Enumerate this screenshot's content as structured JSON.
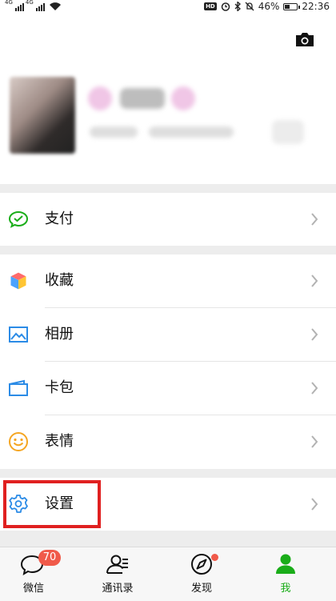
{
  "status_bar": {
    "signal1_label": "4G",
    "signal2_label": "4G",
    "hd_label": "HD",
    "battery_percent": "46%",
    "battery_level": 0.46,
    "time": "22:36"
  },
  "profile": {
    "camera_icon": "camera-icon"
  },
  "menu": {
    "pay": {
      "label": "支付",
      "icon": "wechat-pay-icon",
      "color": "#1aad19"
    },
    "favorites": {
      "label": "收藏",
      "icon": "cube-icon"
    },
    "album": {
      "label": "相册",
      "icon": "picture-icon",
      "color": "#2b8be6"
    },
    "cards": {
      "label": "卡包",
      "icon": "card-icon",
      "color": "#2b8be6"
    },
    "stickers": {
      "label": "表情",
      "icon": "smile-icon",
      "color": "#f5a623"
    },
    "settings": {
      "label": "设置",
      "icon": "gear-icon",
      "color": "#2b8be6"
    }
  },
  "tabbar": {
    "tabs": [
      {
        "label": "微信",
        "badge": "70",
        "icon": "chat-bubble-icon"
      },
      {
        "label": "通讯录",
        "icon": "contacts-icon"
      },
      {
        "label": "发现",
        "icon": "compass-icon",
        "has_dot": true
      },
      {
        "label": "我",
        "icon": "person-icon",
        "active": true
      }
    ],
    "active_color": "#1aad19",
    "badge_color": "#f05a4a"
  }
}
